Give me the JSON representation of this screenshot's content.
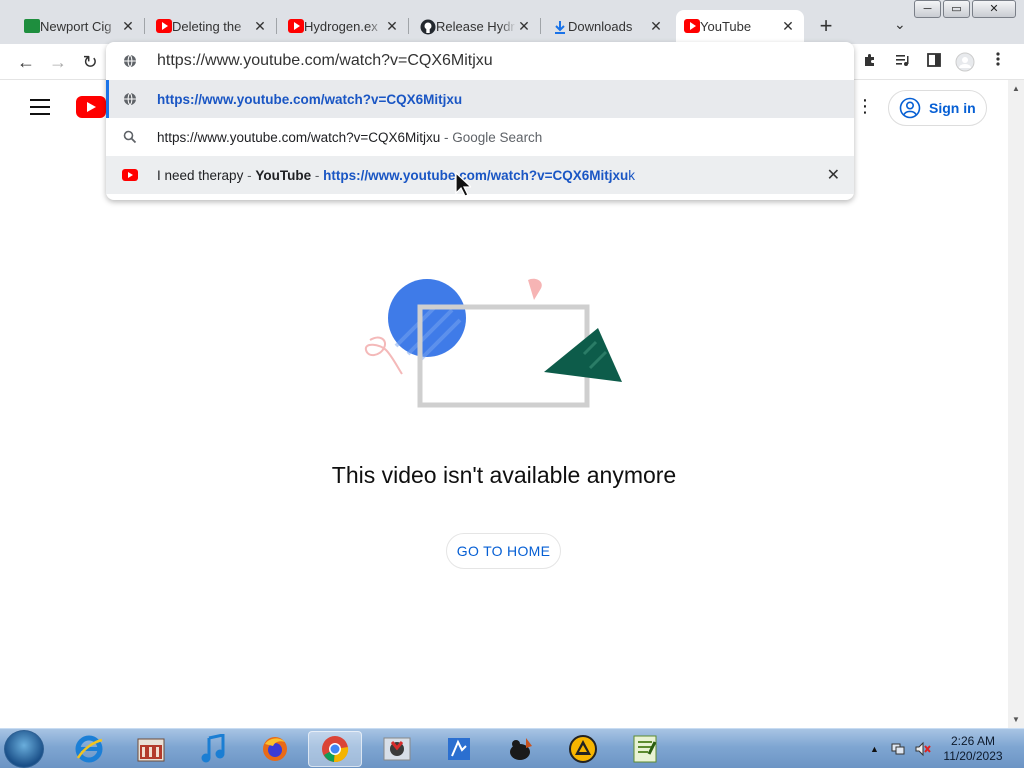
{
  "browser": {
    "tabs": [
      {
        "label": "Newport Cig",
        "favicon": "green-sheet-icon"
      },
      {
        "label": "Deleting the",
        "favicon": "youtube-icon"
      },
      {
        "label": "Hydrogen.ex",
        "favicon": "youtube-icon"
      },
      {
        "label": "Release Hydr",
        "favicon": "github-icon"
      },
      {
        "label": "Downloads",
        "favicon": "download-icon"
      },
      {
        "label": "YouTube",
        "favicon": "youtube-icon"
      }
    ],
    "tab_close": "✕",
    "new_tab": "+",
    "tab_search": "⌄",
    "window_buttons": {
      "minimize": "─",
      "maximize": "▭",
      "close": "✕"
    }
  },
  "toolbar": {
    "back": "←",
    "forward": "→",
    "reload": "↻"
  },
  "omnibox": {
    "input_value": "https://www.youtube.com/watch?v=CQX6Mitjxu",
    "suggestions": [
      {
        "url": "https://www.youtube.com/watch?v=CQX6Mitjxu"
      },
      {
        "query": "https://www.youtube.com/watch?v=CQX6Mitjxu",
        "suffix": "- Google Search"
      },
      {
        "title": "I need therapy",
        "sep1": "-",
        "site": "YouTube",
        "sep2": "-",
        "url_match": "https://www.youtube.com/watch?v=CQX6Mitjxu",
        "url_rest": "k"
      }
    ],
    "remove": "✕"
  },
  "youtube": {
    "signin_label": "Sign in",
    "more_dots": "⋮",
    "error_message": "This video isn't available anymore",
    "home_button": "GO TO HOME"
  },
  "taskbar": {
    "items": [
      "internet-explorer",
      "media-player",
      "itunes",
      "firefox",
      "chrome",
      "java",
      "xenu",
      "gimp",
      "vlc",
      "notepad-plus"
    ],
    "clock_time": "2:26 AM",
    "clock_date": "11/20/2023",
    "tray_arrow": "▲"
  },
  "colors": {
    "accent_blue": "#065fd4",
    "youtube_red": "#ff0000",
    "link_blue": "#1a56c4"
  }
}
